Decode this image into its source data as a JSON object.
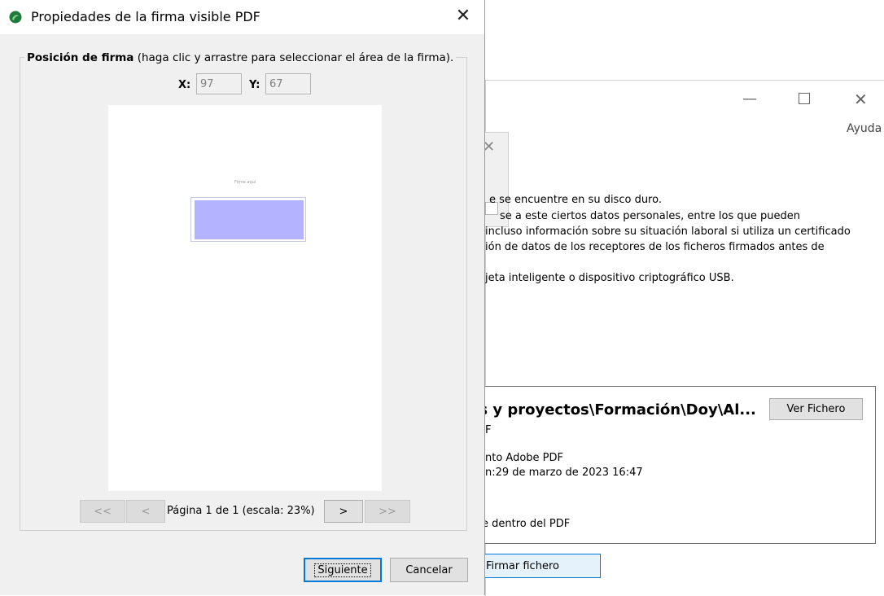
{
  "background_window": {
    "menu_help": "Ayuda",
    "description_lines": [
      "e se encuentre en su disco duro.",
      "se a este ciertos datos personales, entre los que pueden",
      "incluso información sobre su situación laboral si utiliza un certificado",
      "ión de datos de los receptores de los ficheros firmados antes de",
      "jeta inteligente o dispositivo criptográfico USB."
    ],
    "file_panel": {
      "path": "os y proyectos\\Formación\\Doy\\Al...",
      "view_button": "Ver Fichero",
      "type_fragment": "F",
      "type_line": "nto Adobe PDF",
      "date_line": "n:29 de marzo de 2023 16:47",
      "inside_pdf": "e dentro del PDF"
    },
    "sign_button": "Firmar fichero"
  },
  "dialog": {
    "title": "Propiedades de la firma visible PDF",
    "close": "✕",
    "legend_bold": "Posición de firma",
    "legend_rest": " (haga clic y arrastre para seleccionar el área de la firma).",
    "x_label": "X:",
    "x_value": "97",
    "y_label": "Y:",
    "y_value": "67",
    "preview_text": "Firme aquí",
    "nav": {
      "first": "<<",
      "prev": "<",
      "page_info": "Página 1 de 1 (escala: 23%)",
      "next": ">",
      "last": ">>"
    },
    "next_button": "Siguiente",
    "cancel_button": "Cancelar"
  },
  "colors": {
    "signature_area": "#b3b3ff",
    "app_icon": "#1f7a3a",
    "focus_border": "#0078d7"
  }
}
